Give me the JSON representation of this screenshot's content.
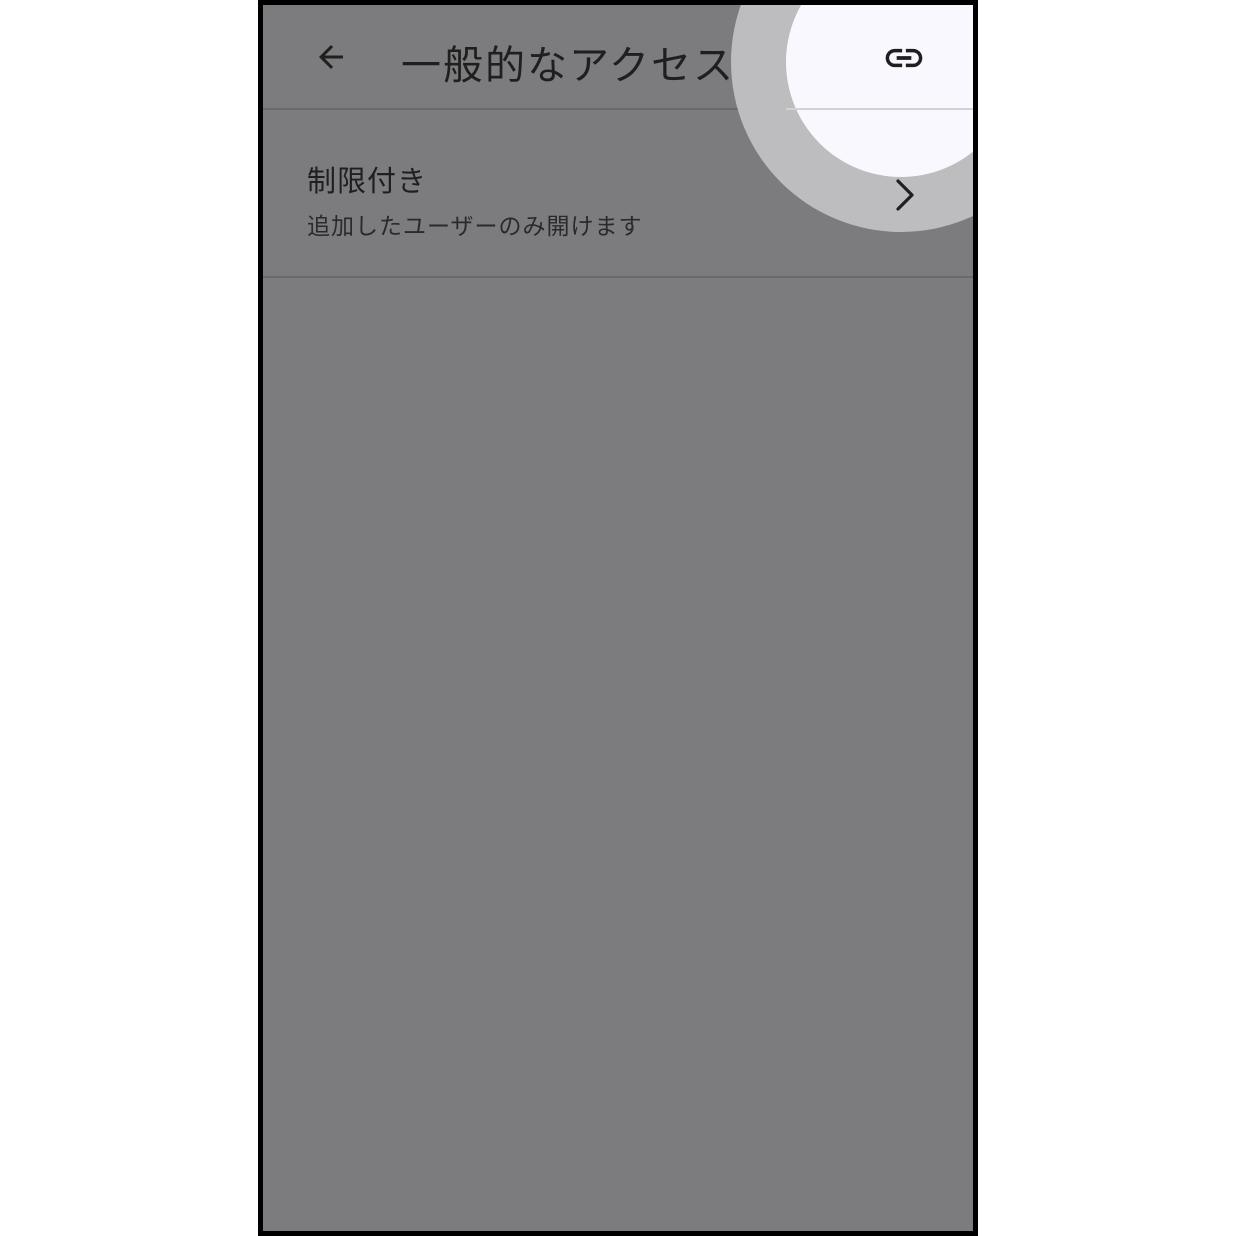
{
  "header": {
    "title": "一般的なアクセス",
    "back_icon": "arrow-back-icon",
    "link_icon": "link-icon"
  },
  "access_row": {
    "title": "制限付き",
    "description": "追加したユーザーのみ開けます",
    "chevron_icon": "chevron-right-icon"
  },
  "colors": {
    "scrim": "#7c7c7e",
    "spotlight_ring": "#bdbdbf",
    "spotlight_core": "#f9f8fe",
    "text": "#1f1f1f"
  }
}
